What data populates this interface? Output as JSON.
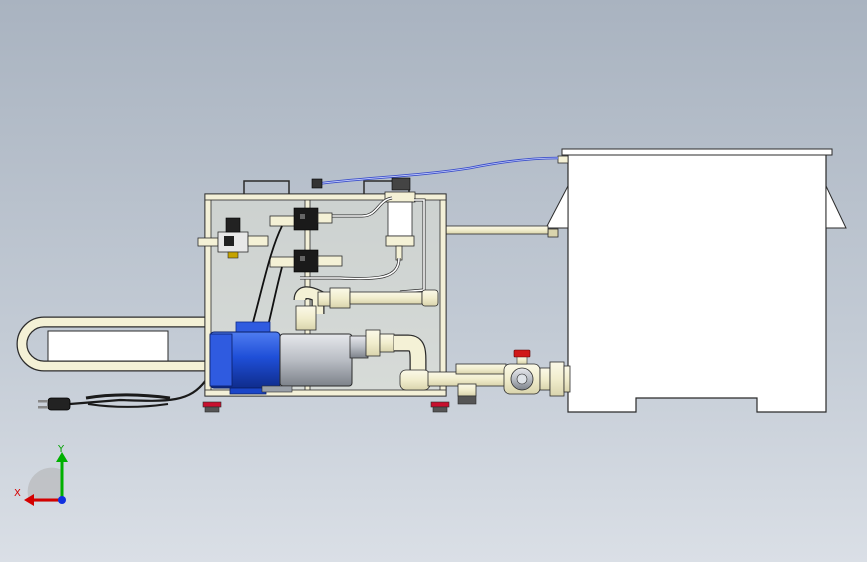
{
  "viewport": {
    "background_top": "#a9b3c0",
    "background_bottom": "#dadfe6"
  },
  "colors": {
    "outline": "#2b2b2b",
    "frame_fill": "#f3f0d8",
    "pipe_fill": "#f4f1d6",
    "tank_fill": "#ffffff",
    "motor_blue": "#1f4fd8",
    "motor_blue_dark": "#0f2c8c",
    "pump_steel": "#b9bdc4",
    "hose_blue": "#3b4fc9",
    "valve_red": "#d01818",
    "foot_red": "#c8102e",
    "axis_x": "#d40000",
    "axis_y": "#00b000",
    "axis_z": "#1030e0"
  },
  "triad": {
    "x_label": "X",
    "y_label": "Y"
  }
}
